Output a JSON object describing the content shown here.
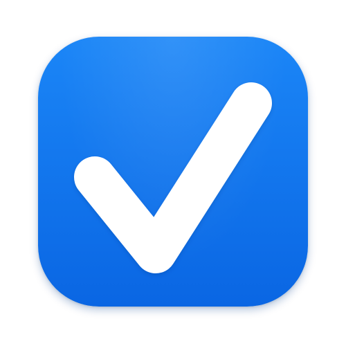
{
  "icon": {
    "name": "checkmark-icon",
    "colors": {
      "background_top": "#1b86f7",
      "background_bottom": "#0a66e3",
      "checkmark": "#ffffff"
    }
  }
}
